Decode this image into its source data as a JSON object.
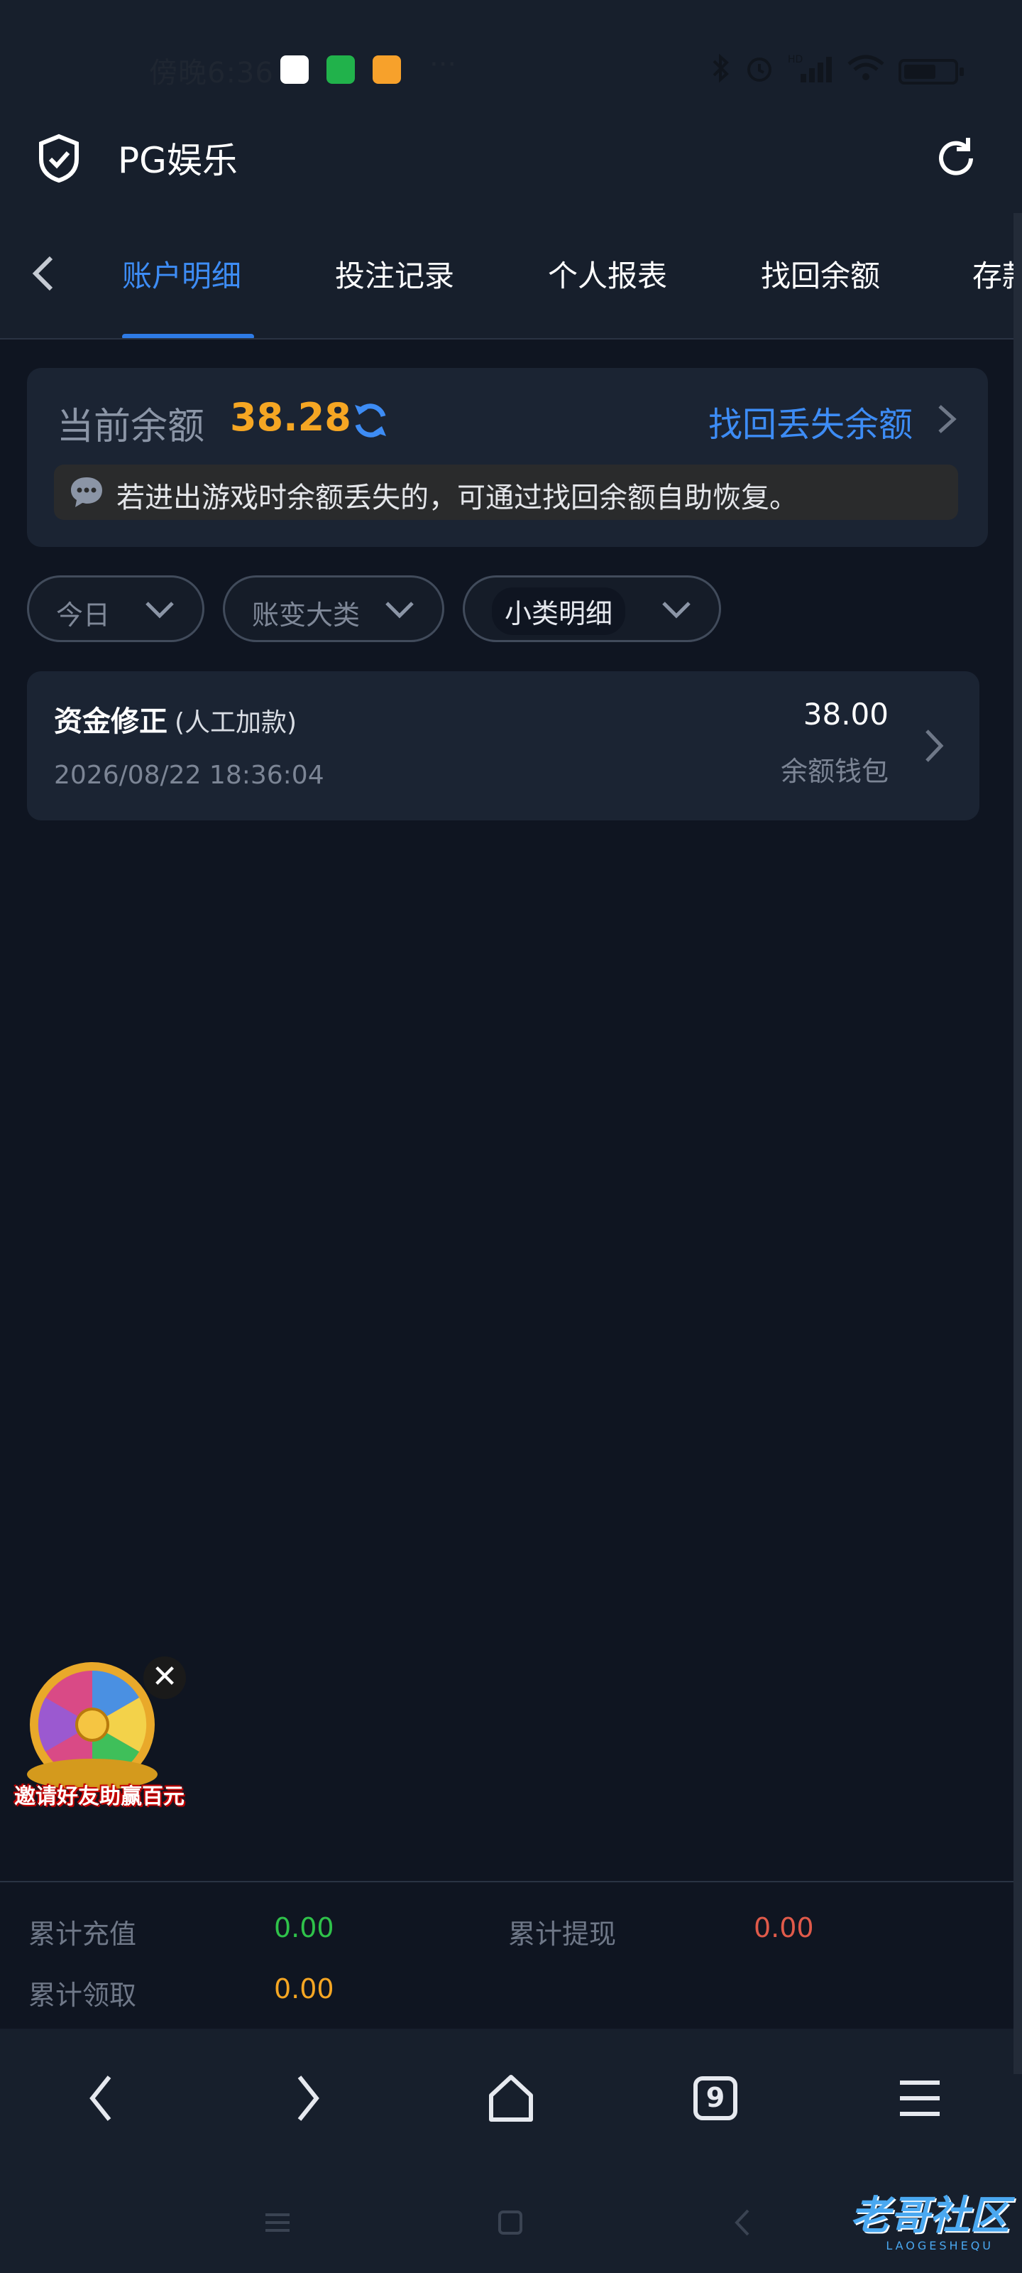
{
  "status_bar": {
    "time": "傍晚6:36",
    "dots": "···",
    "hd_label": "HD"
  },
  "header": {
    "title": "PG娱乐"
  },
  "tabs": [
    {
      "label": "账户明细",
      "active": true
    },
    {
      "label": "投注记录",
      "active": false
    },
    {
      "label": "个人报表",
      "active": false
    },
    {
      "label": "找回余额",
      "active": false
    },
    {
      "label": "存款",
      "active": false
    }
  ],
  "balance": {
    "label": "当前余额",
    "value": "38.28",
    "recover_link": "找回丢失余额",
    "notice": "若进出游戏时余额丢失的，可通过找回余额自助恢复。"
  },
  "filters": [
    {
      "label": "今日"
    },
    {
      "label": "账变大类"
    },
    {
      "label": "小类明细",
      "selected": true
    }
  ],
  "records": [
    {
      "title": "资金修正",
      "subtitle": "(人工加款)",
      "timestamp": "2026/08/22 18:36:04",
      "amount": "38.00",
      "wallet": "余额钱包"
    }
  ],
  "promo": {
    "text": "邀请好友助赢百元",
    "close": "✕"
  },
  "summary": {
    "recharge_label": "累计充值",
    "recharge_value": "0.00",
    "withdraw_label": "累计提现",
    "withdraw_value": "0.00",
    "claim_label": "累计领取",
    "claim_value": "0.00"
  },
  "browser": {
    "tab_count": "9"
  },
  "watermark": {
    "text": "老哥社区",
    "sub": "LAOGESHEQU"
  },
  "colors": {
    "accent": "#3d8cf5",
    "balance": "#f5a623",
    "green": "#2fc24a",
    "red": "#e05a4a",
    "orange": "#f5a623"
  }
}
